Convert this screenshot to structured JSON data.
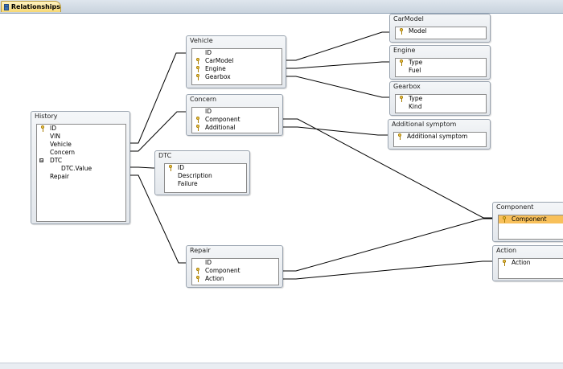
{
  "tab": {
    "title": "Relationships"
  },
  "tables": {
    "history": {
      "title": "History",
      "fields": [
        {
          "label": "ID",
          "key": true
        },
        {
          "label": "VIN",
          "key": false
        },
        {
          "label": "Vehicle",
          "key": false
        },
        {
          "label": "Concern",
          "key": false
        },
        {
          "label": "DTC",
          "key": false,
          "expander": "⊟"
        },
        {
          "label": "DTC.Value",
          "key": false,
          "indent": true
        },
        {
          "label": "Repair",
          "key": false
        }
      ]
    },
    "vehicle": {
      "title": "Vehicle",
      "fields": [
        {
          "label": "ID",
          "key": false
        },
        {
          "label": "CarModel",
          "key": true
        },
        {
          "label": "Engine",
          "key": true
        },
        {
          "label": "Gearbox",
          "key": true
        }
      ]
    },
    "concern": {
      "title": "Concern",
      "fields": [
        {
          "label": "ID",
          "key": false
        },
        {
          "label": "Component",
          "key": true
        },
        {
          "label": "Additional",
          "key": true
        }
      ]
    },
    "dtc": {
      "title": "DTC",
      "fields": [
        {
          "label": "ID",
          "key": true
        },
        {
          "label": "Description",
          "key": false
        },
        {
          "label": "Failure",
          "key": false
        }
      ]
    },
    "repair": {
      "title": "Repair",
      "fields": [
        {
          "label": "ID",
          "key": false
        },
        {
          "label": "Component",
          "key": true
        },
        {
          "label": "Action",
          "key": true
        }
      ]
    },
    "carmodel": {
      "title": "CarModel",
      "fields": [
        {
          "label": "Model",
          "key": true
        }
      ]
    },
    "engine": {
      "title": "Engine",
      "fields": [
        {
          "label": "Type",
          "key": true
        },
        {
          "label": "Fuel",
          "key": false
        }
      ]
    },
    "gearbox": {
      "title": "Gearbox",
      "fields": [
        {
          "label": "Type",
          "key": true
        },
        {
          "label": "Kind",
          "key": false
        }
      ]
    },
    "additional_symptom": {
      "title": "Additional symptom",
      "fields": [
        {
          "label": "Additional symptom",
          "key": true
        }
      ]
    },
    "component": {
      "title": "Component",
      "fields": [
        {
          "label": "Component",
          "key": true,
          "selected": true
        }
      ]
    },
    "action": {
      "title": "Action",
      "fields": [
        {
          "label": "Action",
          "key": true
        }
      ]
    }
  },
  "colors": {
    "selection": "#f8c05a",
    "tab_fill": "#f7d874",
    "line": "#000000"
  },
  "icons": {
    "key_field": "key-icon",
    "tab": "relationships-icon"
  }
}
